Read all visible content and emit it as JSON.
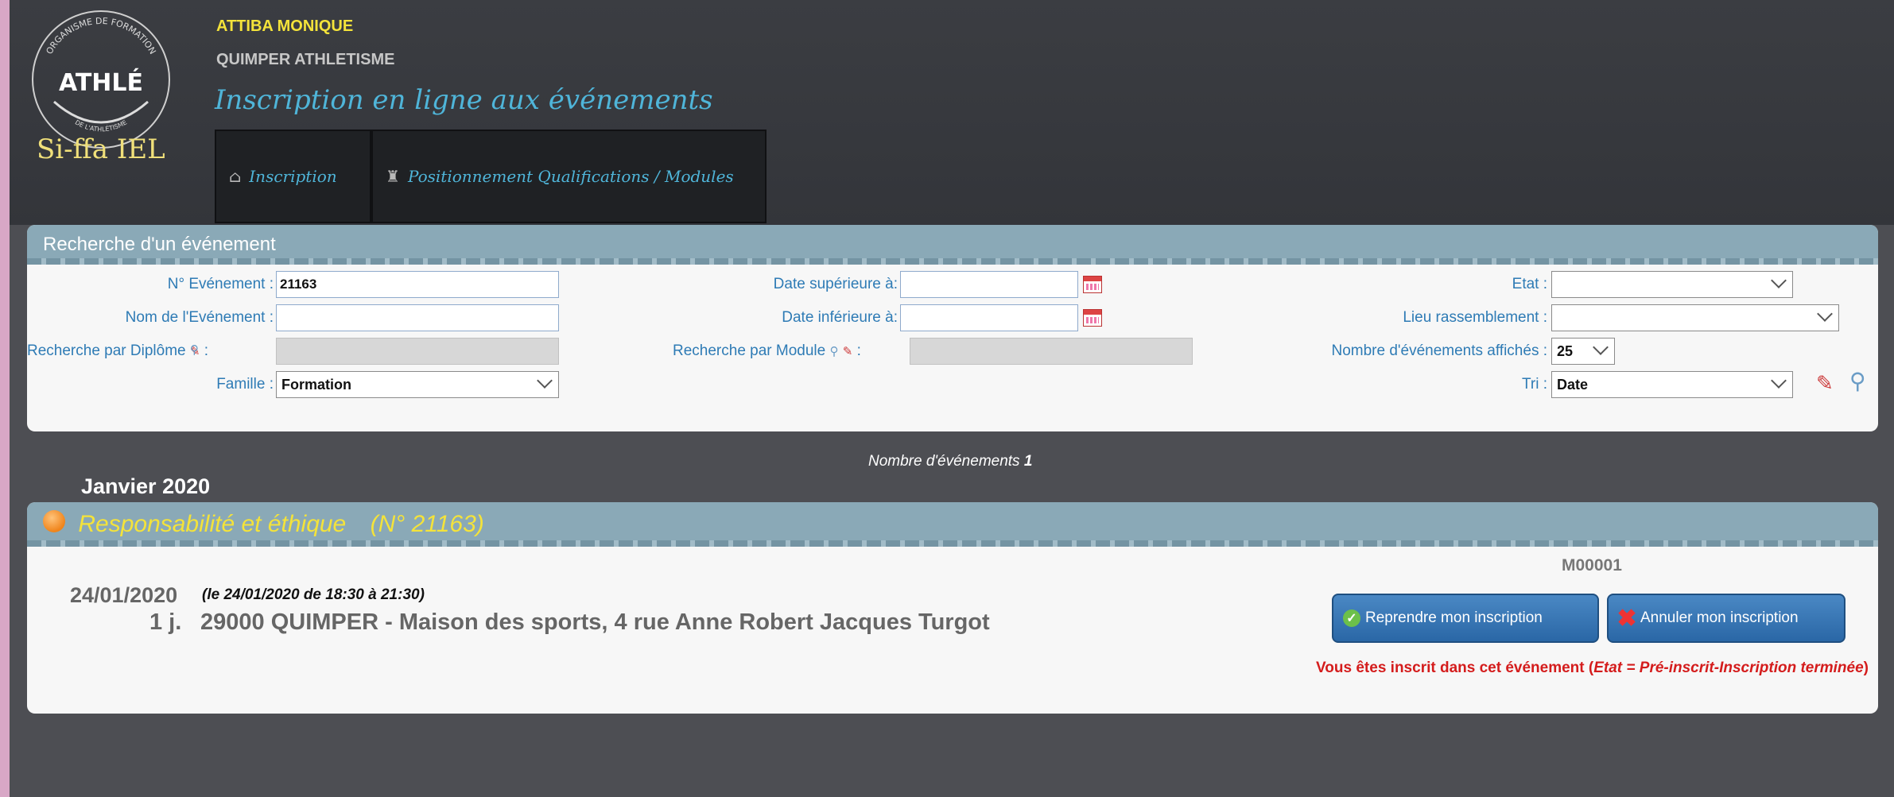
{
  "header": {
    "logo": {
      "ring_text_top": "ORGANISME DE FORMATION",
      "wordmark": "ATHLÉ",
      "ring_text_bottom": "DE L'ATHLÉTISME",
      "caption": "Si-ffa IEL"
    },
    "user_name": "ATTIBA MONIQUE",
    "club_name": "QUIMPER ATHLETISME",
    "app_title": "Inscription en ligne aux événements",
    "nav": [
      {
        "label": "Inscription",
        "icon": "home-icon"
      },
      {
        "label": "Positionnement Qualifications / Modules",
        "icon": "trophy-icon"
      }
    ]
  },
  "search": {
    "title": "Recherche d'un événement",
    "fields": {
      "event_number": {
        "label": "N° Evénement :",
        "value": "21163"
      },
      "event_name": {
        "label": "Nom de l'Evénement :",
        "value": ""
      },
      "diploma": {
        "label": "Recherche par Diplôme",
        "suffix": ":",
        "value": ""
      },
      "family": {
        "label": "Famille :",
        "value": "Formation"
      },
      "date_after": {
        "label": "Date supérieure à:",
        "value": ""
      },
      "date_before": {
        "label": "Date inférieure à:",
        "value": ""
      },
      "module": {
        "label": "Recherche par Module",
        "suffix": ":",
        "value": ""
      },
      "state": {
        "label": "Etat :",
        "value": ""
      },
      "meeting_place": {
        "label": "Lieu rassemblement :",
        "value": ""
      },
      "displayed_count": {
        "label": "Nombre d'événements affichés :",
        "value": "25"
      },
      "sort": {
        "label": "Tri :",
        "value": "Date"
      }
    }
  },
  "results": {
    "count_label": "Nombre d'événements",
    "count_value": "1",
    "month": "Janvier 2020"
  },
  "event": {
    "title": "Responsabilité et éthique",
    "number": "(N° 21163)",
    "date": "24/01/2020",
    "when": "(le 24/01/2020 de 18:30 à 21:30)",
    "duration": "1 j.",
    "place": "29000 QUIMPER - Maison des sports, 4 rue Anne Robert Jacques Turgot",
    "code": "M00001",
    "resume_button": "Reprendre mon inscription",
    "cancel_button": "Annuler mon inscription",
    "status_prefix": "Vous êtes inscrit dans cet événement (",
    "status_detail": "Etat = Pré-inscrit-Inscription terminée",
    "status_suffix": ")"
  },
  "colors": {
    "accent_blue": "#4fb5d9",
    "user_yellow": "#f4e33a",
    "panel_header": "#8aa9b7",
    "status_red": "#d41c1c",
    "button_blue": "#2a67a6"
  }
}
